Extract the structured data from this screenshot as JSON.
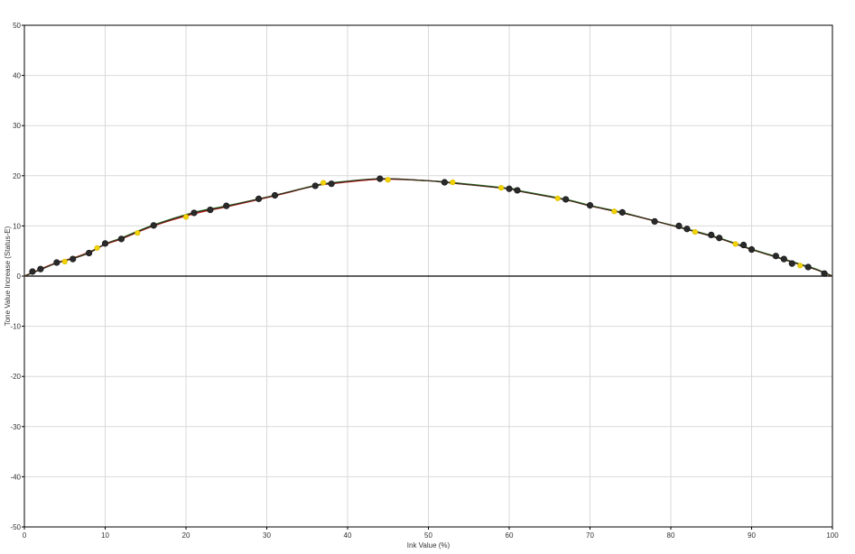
{
  "chart_data": {
    "type": "line",
    "title": "",
    "xlabel": "Ink Value (%)",
    "ylabel": "Tone Value Increase (Status-E)",
    "xlim": [
      0,
      100
    ],
    "ylim": [
      -50,
      50
    ],
    "x_ticks": [
      "0",
      "10",
      "20",
      "30",
      "40",
      "50",
      "60",
      "70",
      "80",
      "90",
      "100"
    ],
    "y_ticks": [
      "50",
      "40",
      "30",
      "20",
      "10",
      "0",
      "-10",
      "-20",
      "-30",
      "-40",
      "-50"
    ],
    "grid": true,
    "legend": "none",
    "colors": {
      "curve_1": "#cc2222",
      "curve_2": "#2b7a2b",
      "curve_3": "#3a2a1a",
      "points_dark": "#2a2a2a",
      "points_yellow": "#f2d200",
      "grid": "#d9d9d9",
      "zero_line": "#000000"
    },
    "series": [
      {
        "style": "line",
        "color": "#cc2222",
        "x": [
          0,
          2,
          4,
          6,
          8,
          10,
          12,
          16,
          21,
          25,
          31,
          36,
          38,
          44,
          50,
          52,
          60,
          61,
          67,
          70,
          74,
          78,
          82,
          86,
          90,
          93,
          96,
          98,
          100
        ],
        "y": [
          0,
          1.4,
          2.7,
          3.6,
          4.8,
          6.3,
          7.4,
          10.0,
          12.4,
          13.8,
          16.0,
          18.0,
          18.4,
          19.3,
          19.0,
          18.7,
          17.4,
          17.0,
          15.2,
          14.0,
          12.6,
          11.0,
          9.3,
          7.5,
          5.3,
          3.8,
          2.3,
          1.3,
          0
        ]
      },
      {
        "style": "line",
        "color": "#2b7a2b",
        "x": [
          0,
          2,
          4,
          6,
          8,
          10,
          12,
          16,
          21,
          25,
          31,
          36,
          38,
          44,
          50,
          52,
          60,
          61,
          67,
          70,
          74,
          78,
          82,
          86,
          90,
          93,
          96,
          98,
          100
        ],
        "y": [
          0,
          1.3,
          2.6,
          3.5,
          4.7,
          6.4,
          7.6,
          10.2,
          12.7,
          14.0,
          16.1,
          18.1,
          18.6,
          19.4,
          19.0,
          18.8,
          17.5,
          17.1,
          15.3,
          14.1,
          12.7,
          11.0,
          9.4,
          7.6,
          5.4,
          3.9,
          2.4,
          1.4,
          0
        ]
      },
      {
        "style": "line",
        "color": "#3a2a1a",
        "x": [
          0,
          2,
          4,
          6,
          8,
          10,
          12,
          16,
          21,
          25,
          31,
          36,
          38,
          44,
          50,
          52,
          60,
          61,
          67,
          70,
          74,
          78,
          82,
          86,
          90,
          93,
          96,
          98,
          100
        ],
        "y": [
          0,
          1.3,
          2.6,
          3.5,
          4.6,
          6.4,
          7.5,
          10.1,
          12.6,
          13.9,
          16.1,
          18.0,
          18.5,
          19.4,
          19.0,
          18.7,
          17.4,
          17.0,
          15.2,
          14.0,
          12.6,
          11.0,
          9.3,
          7.5,
          5.3,
          3.8,
          2.3,
          1.3,
          0
        ]
      },
      {
        "style": "points",
        "color": "#2a2a2a",
        "x": [
          1,
          2,
          4,
          6,
          8,
          10,
          12,
          16,
          21,
          23,
          25,
          29,
          31,
          36,
          38,
          44,
          52,
          60,
          61,
          67,
          70,
          74,
          78,
          81,
          82,
          85,
          86,
          89,
          90,
          93,
          94,
          95,
          97,
          99
        ],
        "y": [
          0.9,
          1.4,
          2.7,
          3.4,
          4.6,
          6.5,
          7.4,
          10.1,
          12.6,
          13.2,
          14.0,
          15.4,
          16.1,
          18.0,
          18.4,
          19.4,
          18.7,
          17.4,
          17.1,
          15.3,
          14.1,
          12.7,
          10.9,
          10.0,
          9.4,
          8.2,
          7.6,
          6.2,
          5.3,
          4.0,
          3.4,
          2.5,
          1.8,
          0.5
        ]
      },
      {
        "style": "points",
        "color": "#f2d200",
        "x": [
          5,
          9,
          14,
          20,
          37,
          45,
          53,
          59,
          66,
          73,
          83,
          88,
          96
        ],
        "y": [
          2.9,
          5.6,
          8.6,
          11.8,
          18.6,
          19.2,
          18.7,
          17.6,
          15.5,
          12.9,
          8.8,
          6.4,
          2.1
        ]
      }
    ]
  }
}
